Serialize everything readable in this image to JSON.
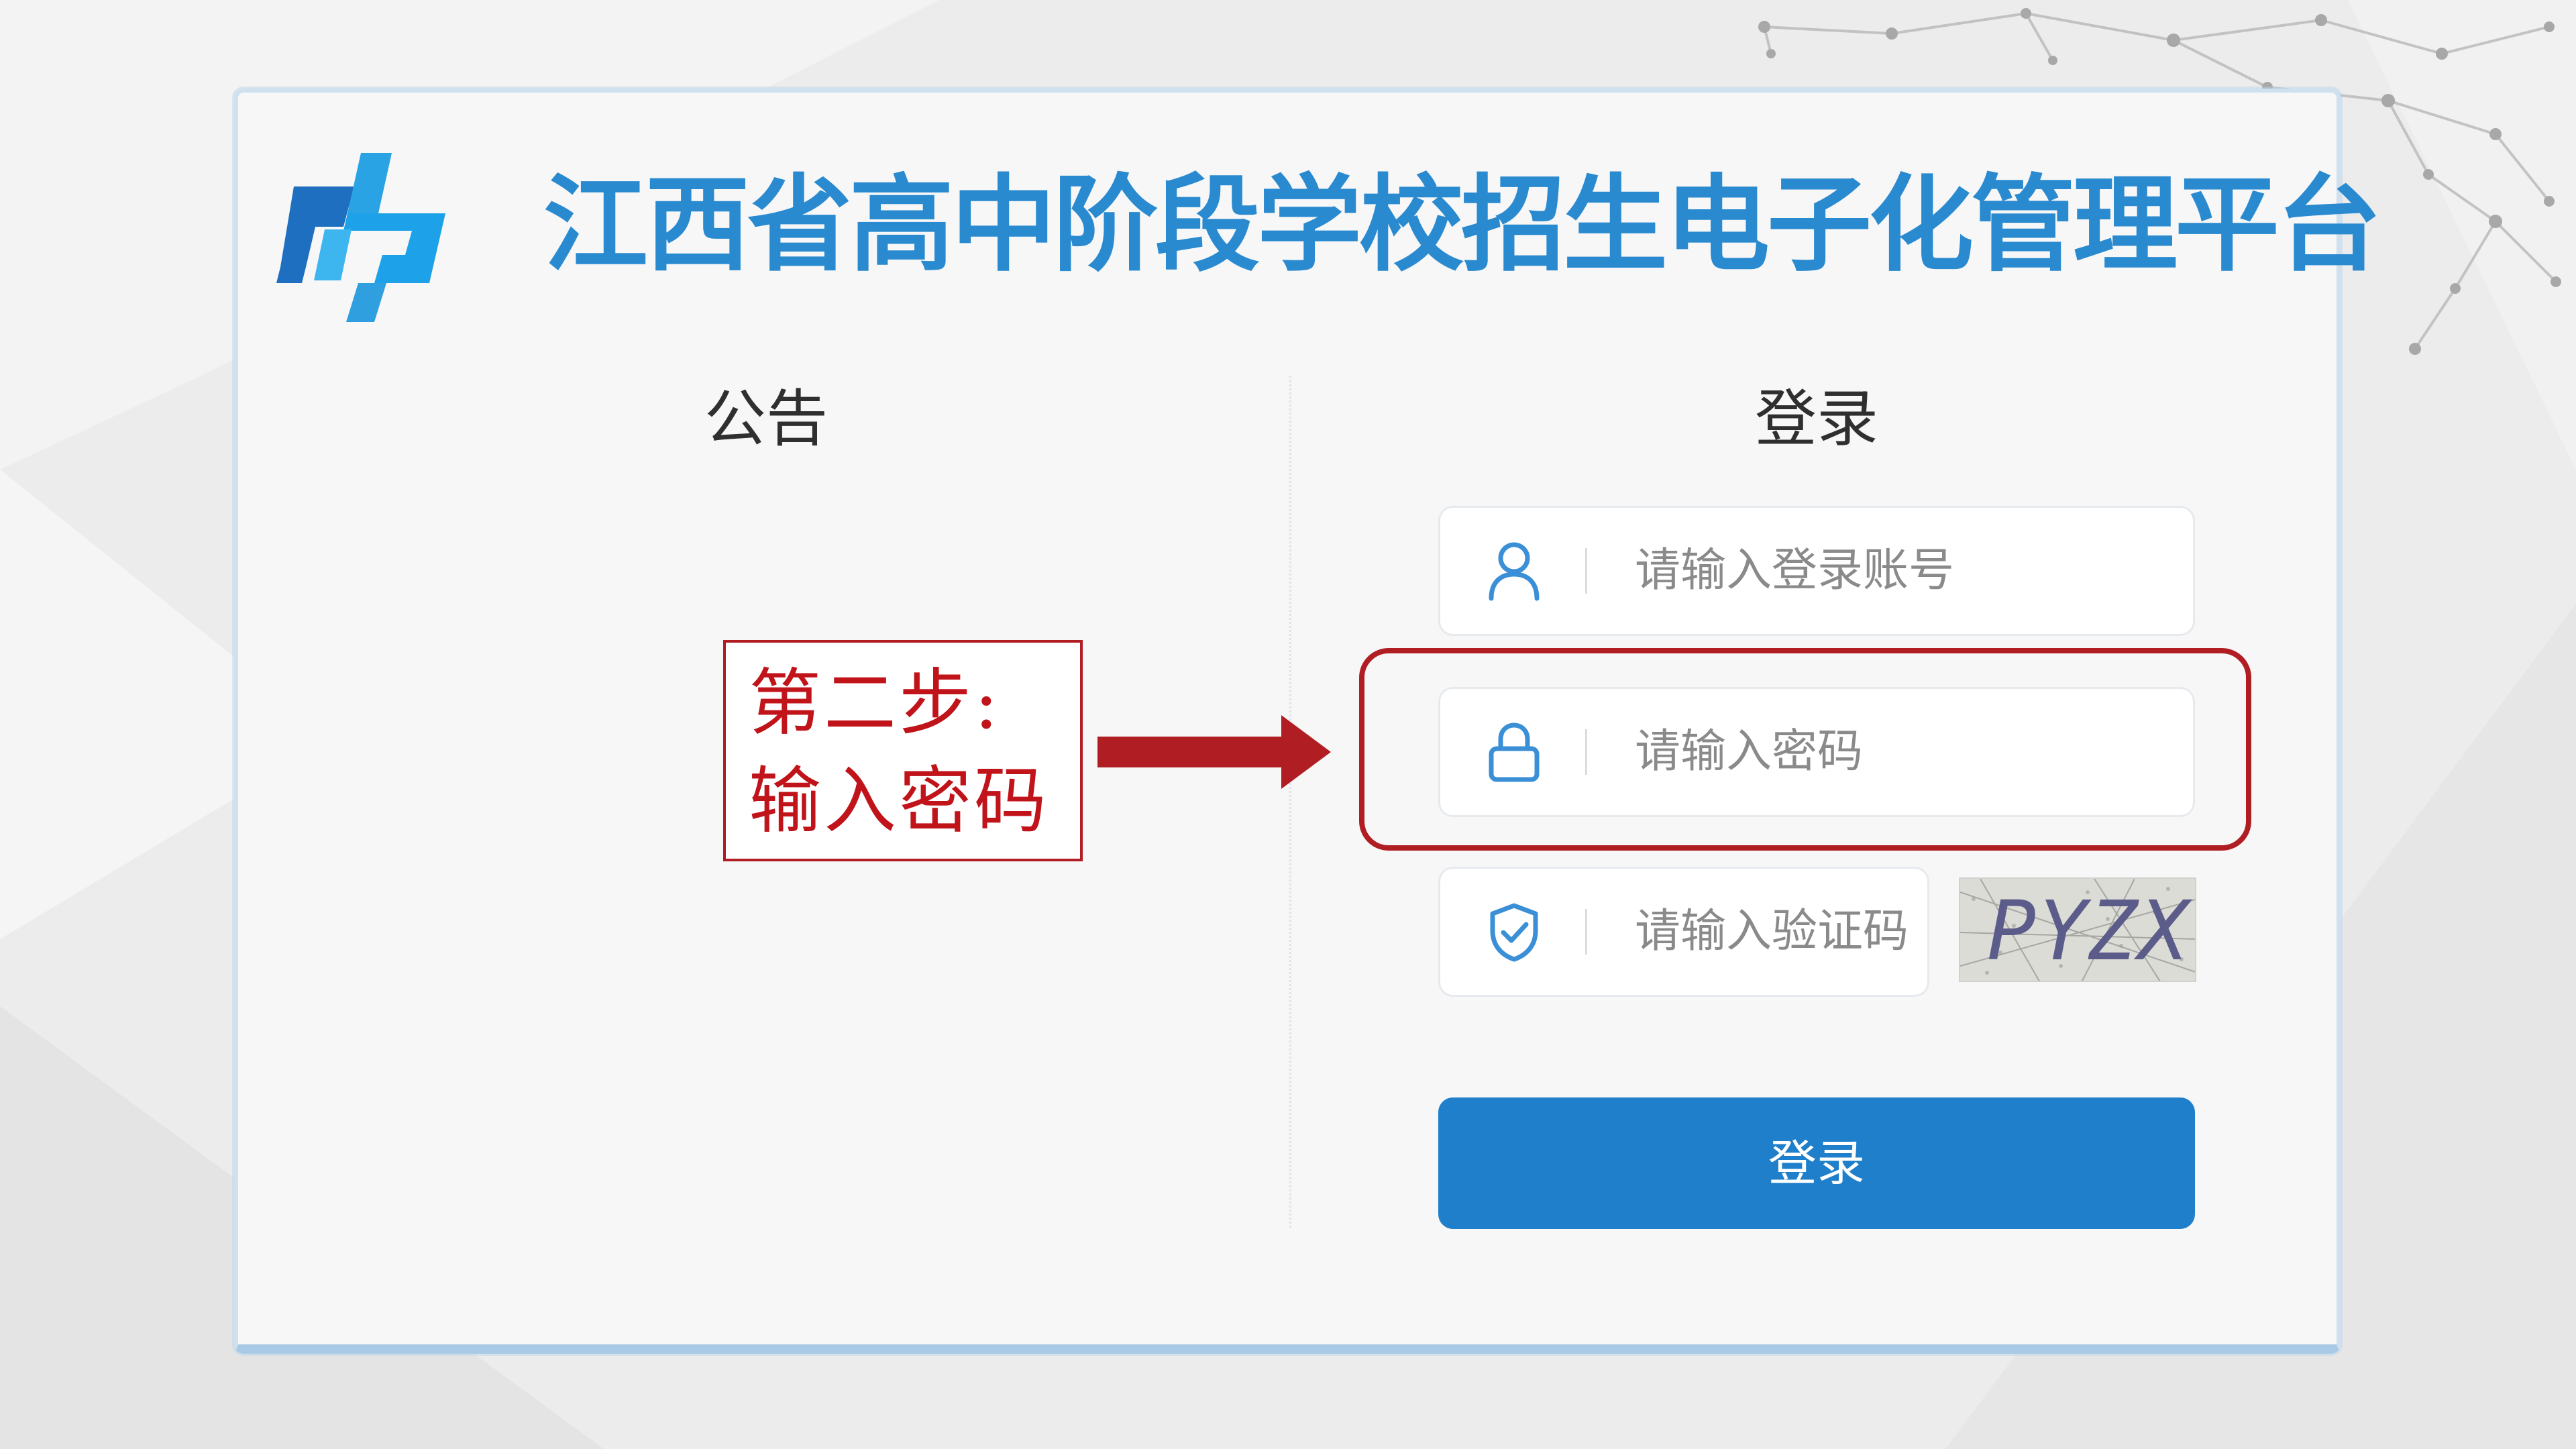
{
  "header": {
    "title": "江西省高中阶段学校招生电子化管理平台",
    "logo_icon": "cp-platform-logo"
  },
  "notice": {
    "heading": "公告"
  },
  "login": {
    "heading": "登录",
    "username_placeholder": "请输入登录账号",
    "password_placeholder": "请输入密码",
    "captcha_placeholder": "请输入验证码",
    "captcha_text": "PYZX",
    "submit_label": "登录",
    "icons": {
      "username": "user-icon",
      "password": "lock-icon",
      "captcha": "shield-check-icon"
    }
  },
  "annotation": {
    "line1": "第二步:",
    "line2": "输入密码"
  },
  "colors": {
    "brand_blue": "#2a8ad0",
    "button_blue": "#1f7fca",
    "annotation_red": "#b01e24",
    "icon_blue": "#3a8fd6"
  }
}
